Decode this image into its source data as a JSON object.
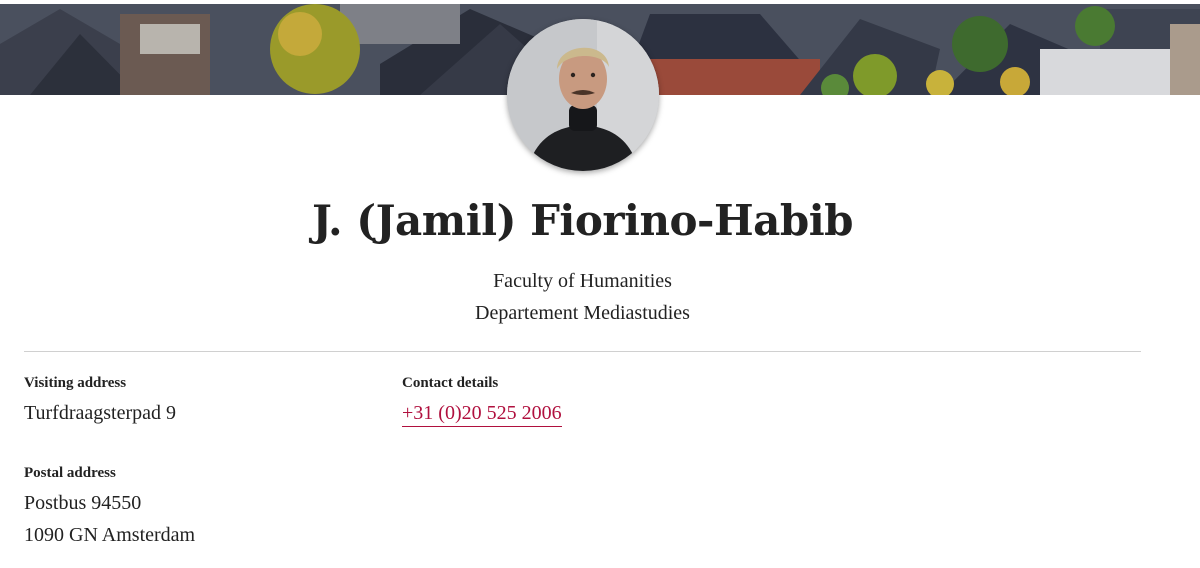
{
  "profile": {
    "name": "J. (Jamil) Fiorino-Habib",
    "faculty": "Faculty of Humanities",
    "department": "Departement Mediastudies"
  },
  "visiting": {
    "label": "Visiting address",
    "line1": "Turfdraagsterpad 9"
  },
  "contact": {
    "label": "Contact details",
    "phone": "+31 (0)20 525 2006"
  },
  "postal": {
    "label": "Postal address",
    "line1": "Postbus 94550",
    "line2": "1090 GN Amsterdam"
  },
  "colors": {
    "link": "#b0103e",
    "text": "#222222",
    "divider": "#d0d0d0"
  }
}
